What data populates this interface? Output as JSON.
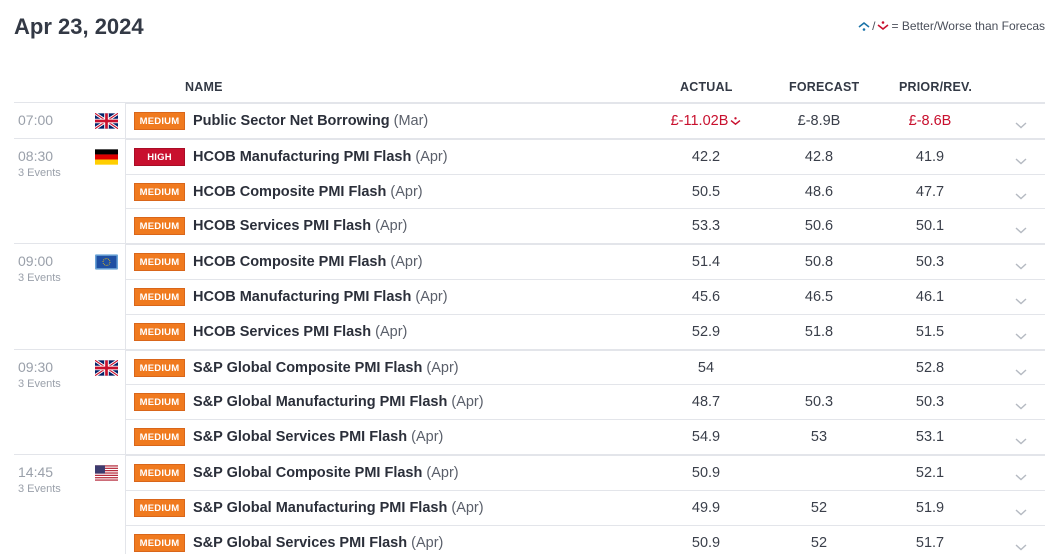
{
  "date": "Apr 23, 2024",
  "legend_text": "= Better/Worse than Forecas",
  "headers": {
    "name": "NAME",
    "actual": "ACTUAL",
    "forecast": "FORECAST",
    "prior": "PRIOR/REV."
  },
  "colors": {
    "medium": "#f07a1f",
    "high": "#c8102e",
    "worse": "#c8102e",
    "better": "#1a73a8"
  },
  "groups": [
    {
      "time": "07:00",
      "events_label": "",
      "flag": "uk-flag",
      "rows": [
        {
          "impact": "MEDIUM",
          "name": "Public Sector Net Borrowing",
          "period": "(Mar)",
          "actual": "£-11.02B",
          "forecast": "£-8.9B",
          "prior": "£-8.6B",
          "actual_trend": "worse"
        }
      ]
    },
    {
      "time": "08:30",
      "events_label": "3 Events",
      "flag": "germany-flag",
      "rows": [
        {
          "impact": "HIGH",
          "name": "HCOB Manufacturing PMI Flash",
          "period": "(Apr)",
          "actual": "42.2",
          "forecast": "42.8",
          "prior": "41.9"
        },
        {
          "impact": "MEDIUM",
          "name": "HCOB Composite PMI Flash",
          "period": "(Apr)",
          "actual": "50.5",
          "forecast": "48.6",
          "prior": "47.7"
        },
        {
          "impact": "MEDIUM",
          "name": "HCOB Services PMI Flash",
          "period": "(Apr)",
          "actual": "53.3",
          "forecast": "50.6",
          "prior": "50.1"
        }
      ]
    },
    {
      "time": "09:00",
      "events_label": "3 Events",
      "flag": "eu-flag",
      "rows": [
        {
          "impact": "MEDIUM",
          "name": "HCOB Composite PMI Flash",
          "period": "(Apr)",
          "actual": "51.4",
          "forecast": "50.8",
          "prior": "50.3"
        },
        {
          "impact": "MEDIUM",
          "name": "HCOB Manufacturing PMI Flash",
          "period": "(Apr)",
          "actual": "45.6",
          "forecast": "46.5",
          "prior": "46.1"
        },
        {
          "impact": "MEDIUM",
          "name": "HCOB Services PMI Flash",
          "period": "(Apr)",
          "actual": "52.9",
          "forecast": "51.8",
          "prior": "51.5"
        }
      ]
    },
    {
      "time": "09:30",
      "events_label": "3 Events",
      "flag": "uk-flag",
      "rows": [
        {
          "impact": "MEDIUM",
          "name": "S&P Global Composite PMI Flash",
          "period": "(Apr)",
          "actual": "54",
          "forecast": "",
          "prior": "52.8"
        },
        {
          "impact": "MEDIUM",
          "name": "S&P Global Manufacturing PMI Flash",
          "period": "(Apr)",
          "actual": "48.7",
          "forecast": "50.3",
          "prior": "50.3"
        },
        {
          "impact": "MEDIUM",
          "name": "S&P Global Services PMI Flash",
          "period": "(Apr)",
          "actual": "54.9",
          "forecast": "53",
          "prior": "53.1"
        }
      ]
    },
    {
      "time": "14:45",
      "events_label": "3 Events",
      "flag": "us-flag",
      "rows": [
        {
          "impact": "MEDIUM",
          "name": "S&P Global Composite PMI Flash",
          "period": "(Apr)",
          "actual": "50.9",
          "forecast": "",
          "prior": "52.1"
        },
        {
          "impact": "MEDIUM",
          "name": "S&P Global Manufacturing PMI Flash",
          "period": "(Apr)",
          "actual": "49.9",
          "forecast": "52",
          "prior": "51.9"
        },
        {
          "impact": "MEDIUM",
          "name": "S&P Global Services PMI Flash",
          "period": "(Apr)",
          "actual": "50.9",
          "forecast": "52",
          "prior": "51.7"
        }
      ]
    }
  ]
}
